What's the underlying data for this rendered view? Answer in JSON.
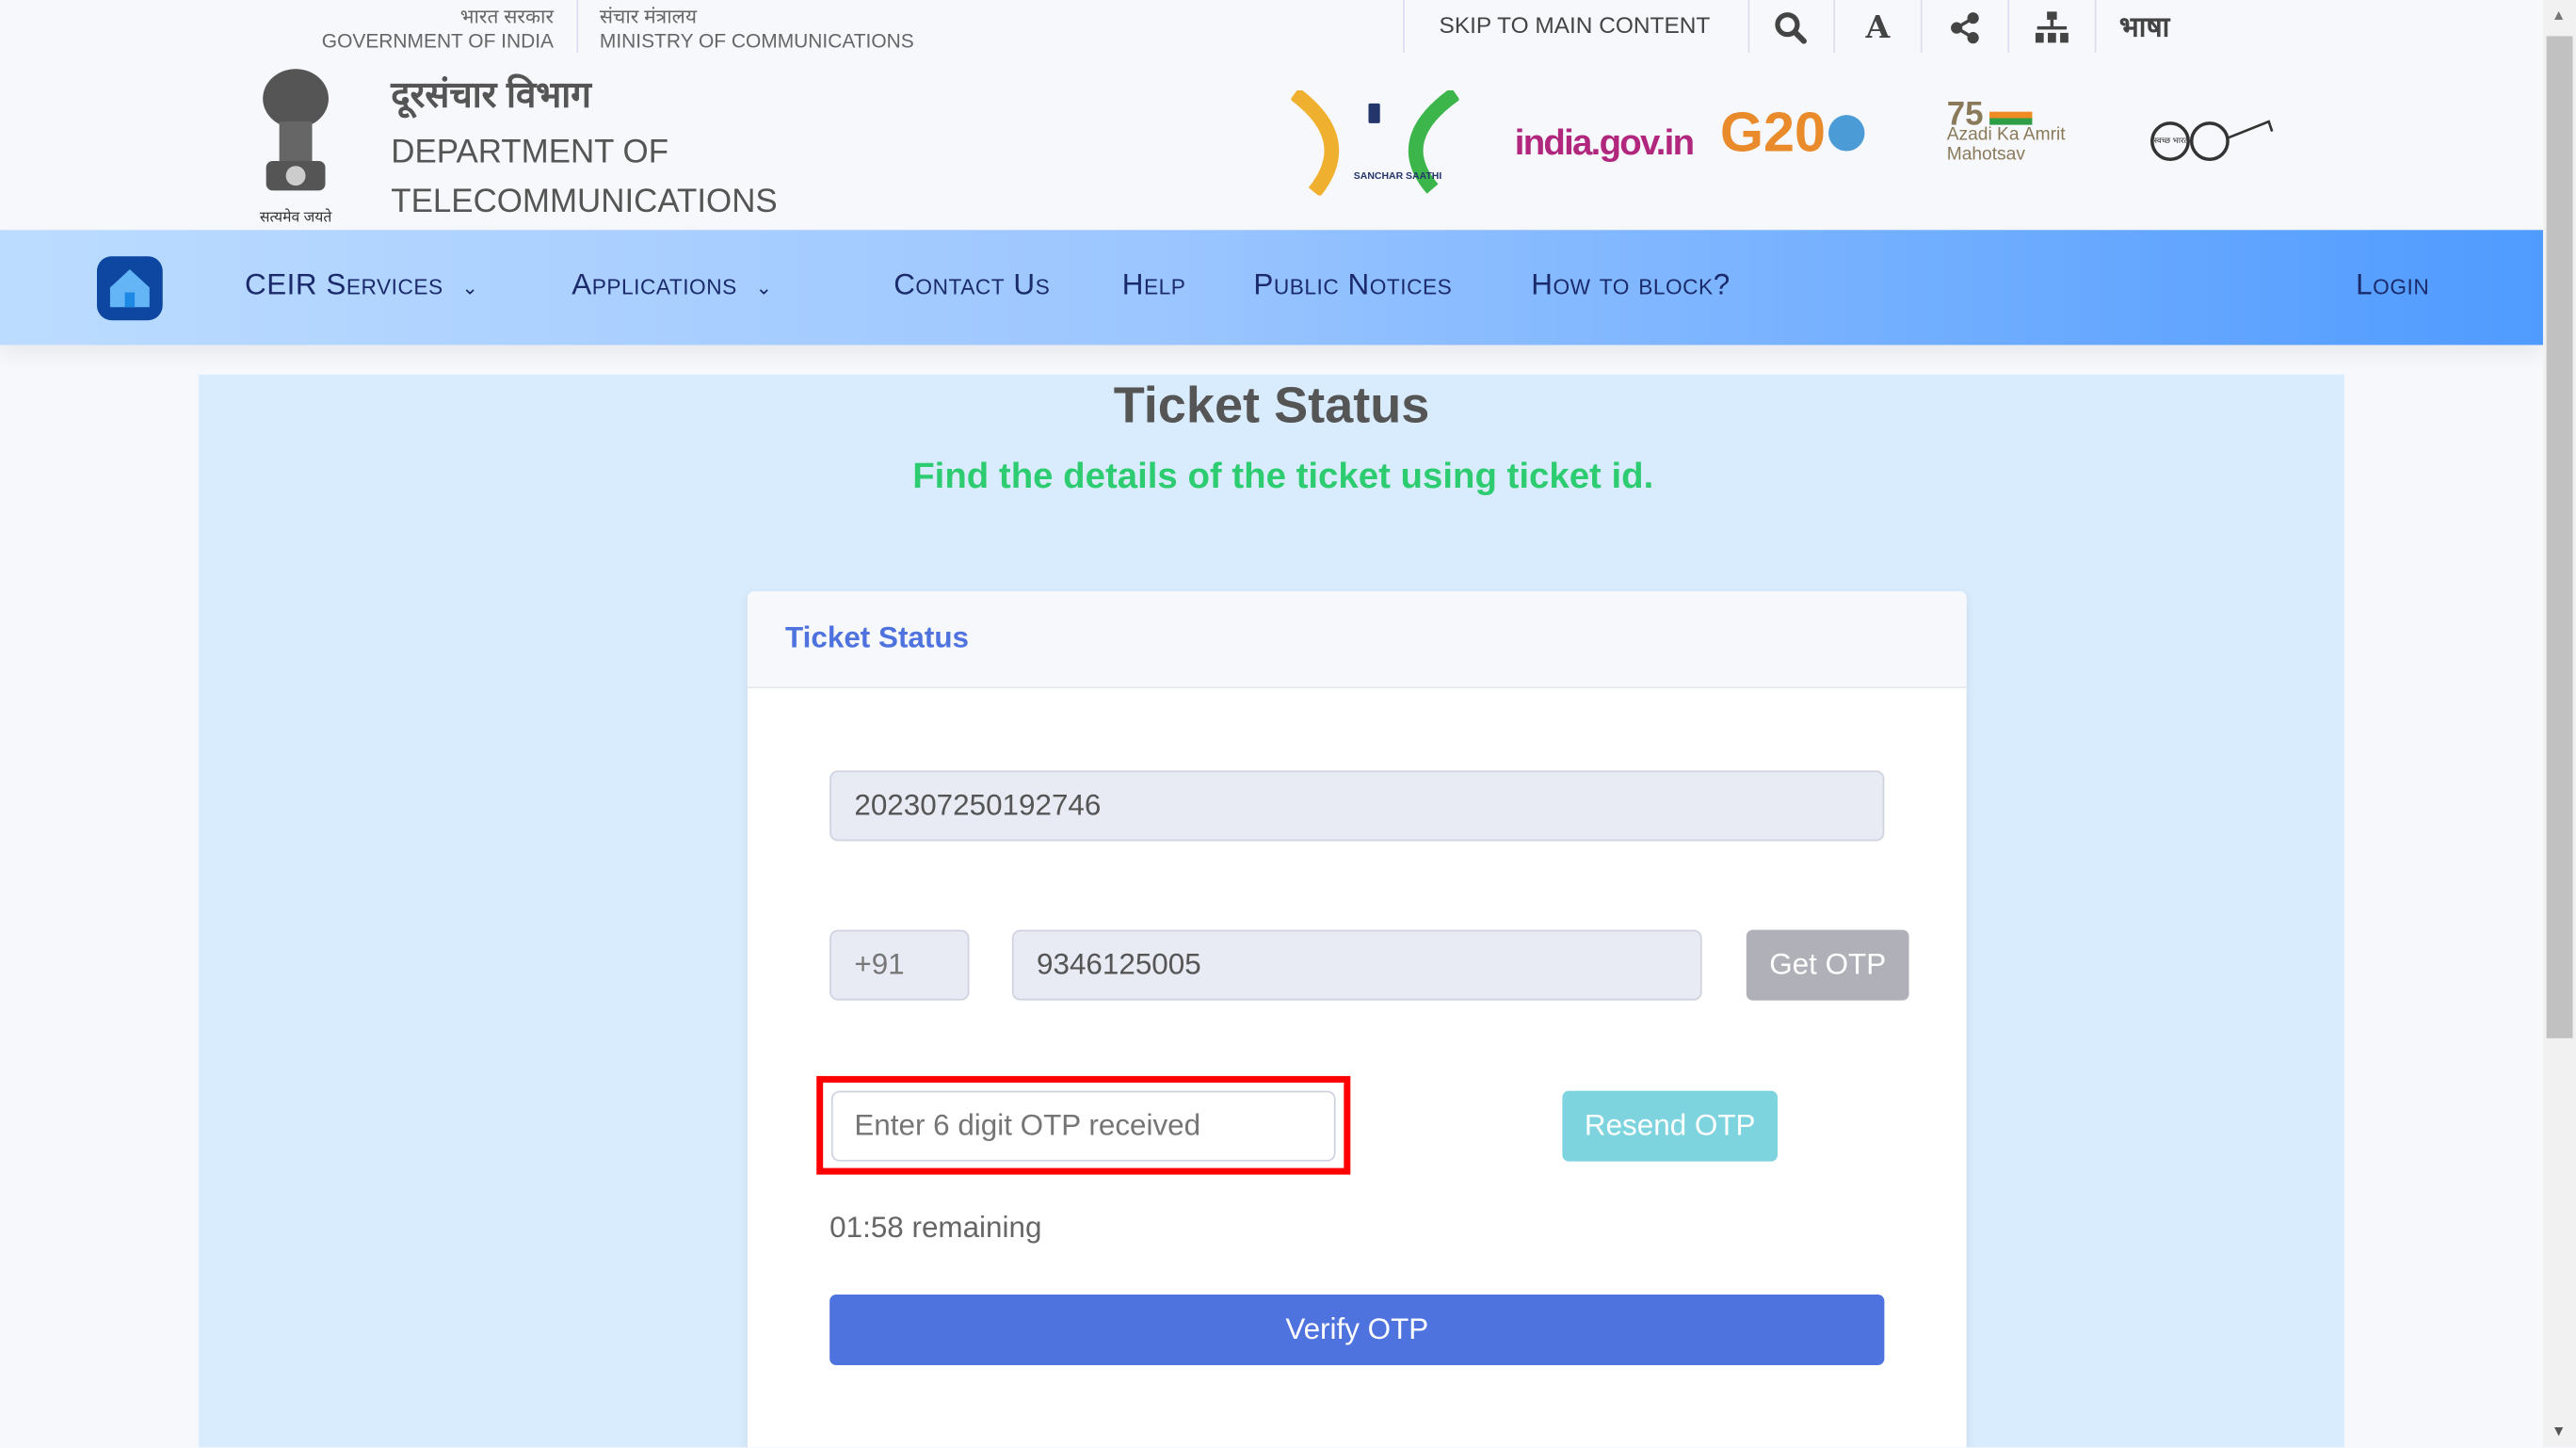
{
  "header": {
    "gov_hindi": "भारत सरकार",
    "gov_english": "GOVERNMENT OF INDIA",
    "ministry_hindi": "संचार मंत्रालय",
    "ministry_english": "MINISTRY OF COMMUNICATIONS",
    "skip_link": "SKIP TO MAIN CONTENT",
    "font_size_label": "A",
    "language_label": "भाषा",
    "dept_hindi": "दूरसंचार विभाग",
    "dept_line1": "DEPARTMENT OF",
    "dept_line2": "TELECOMMUNICATIONS",
    "emblem_motto": "सत्यमेव जयते",
    "logos": {
      "sanchar_saathi": "SANCHAR SAATHI",
      "india_gov": "india.gov.in",
      "g20": "G20",
      "azadi": "Azadi Ka Amrit Mahotsav",
      "swachh": "स्वच्छ भारत"
    }
  },
  "nav": {
    "items": [
      {
        "label": "CEIR Services",
        "dropdown": true
      },
      {
        "label": "Applications",
        "dropdown": true
      },
      {
        "label": "Contact Us"
      },
      {
        "label": "Help"
      },
      {
        "label": "Public Notices"
      },
      {
        "label": "How to block?"
      }
    ],
    "login": "Login"
  },
  "main": {
    "title": "Ticket Status",
    "subtitle": "Find the details of the ticket using ticket id.",
    "card_title": "Ticket Status",
    "ticket_id": "202307250192746",
    "country_code": "+91",
    "mobile": "9346125005",
    "get_otp": "Get OTP",
    "otp_placeholder": "Enter 6 digit OTP received",
    "resend_otp": "Resend OTP",
    "timer": "01:58 remaining",
    "verify_otp": "Verify OTP"
  },
  "colors": {
    "accent": "#4e73df",
    "subtitle": "#2ecc71",
    "resend": "#7dd3de",
    "get_otp": "#b0b1b8",
    "highlight": "#ff0000"
  }
}
